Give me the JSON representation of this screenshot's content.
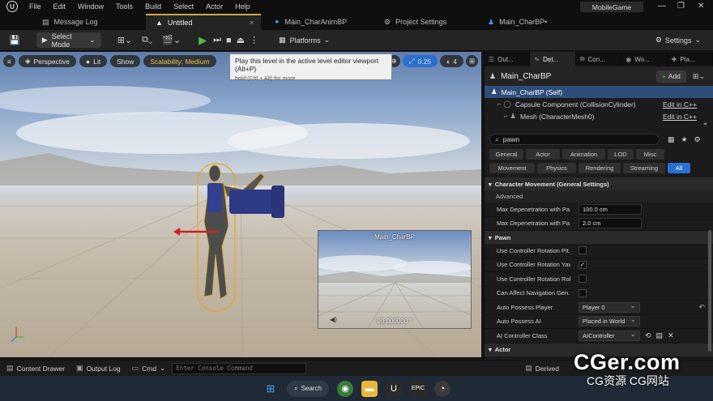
{
  "menu": {
    "items": [
      "File",
      "Edit",
      "Window",
      "Tools",
      "Build",
      "Select",
      "Actor",
      "Help"
    ],
    "app_name": "MobileGame"
  },
  "tabs": [
    {
      "label": "Message Log",
      "icon": "message-log-icon"
    },
    {
      "label": "Untitled",
      "icon": "level-icon"
    },
    {
      "label": "Main_CharAnimBP",
      "icon": "anim-blueprint-icon"
    },
    {
      "label": "Project Settings",
      "icon": "settings-icon"
    },
    {
      "label": "Main_CharBP•",
      "icon": "blueprint-icon"
    }
  ],
  "toolbar": {
    "select_mode": "Select Mode",
    "platforms": "Platforms",
    "settings": "Settings"
  },
  "viewport": {
    "perspective": "Perspective",
    "lit": "Lit",
    "show": "Show",
    "scalability": "Scalability: Medium",
    "camera_speed": "0.25",
    "grid_count": "4",
    "tooltip_title": "Play this level in the active level editor viewport (Alt+P)",
    "tooltip_hint": "hold (Ctrl + Alt) for more",
    "preview_title": "Main_CharBP",
    "preview_fov": "90.000000 °"
  },
  "details": {
    "panel_tabs": [
      {
        "label": "Out...",
        "icon": "outliner-icon"
      },
      {
        "label": "Det...",
        "icon": "details-icon"
      },
      {
        "label": "Con...",
        "icon": "components-icon"
      },
      {
        "label": "Wo...",
        "icon": "world-icon"
      },
      {
        "label": "Pla...",
        "icon": "place-icon"
      }
    ],
    "actor_name": "Main_CharBP",
    "add_label": "Add",
    "tree": {
      "self": "Main_CharBP (Self)",
      "capsule": "Capsule Component (CollisionCylinder)",
      "mesh": "Mesh (CharacterMesh0)",
      "edit_cpp": "Edit in C++"
    },
    "search_value": "pawn",
    "categories_row1": [
      "General",
      "Actor",
      "Animation",
      "LOD",
      "Misc"
    ],
    "categories_row2": [
      "Movement",
      "Physics",
      "Rendering",
      "Streaming",
      "All"
    ],
    "sections": {
      "char_movement": "Character Movement (General Settings)",
      "advanced": "Advanced",
      "pawn": "Pawn",
      "actor": "Actor"
    },
    "props": {
      "max_depen_1_label": "Max Depenetration with Pa...",
      "max_depen_1_value": "100.0 cm",
      "max_depen_2_label": "Max Depenetration with Pa...",
      "max_depen_2_value": "2.0 cm",
      "use_pitch": "Use Controller Rotation Pit...",
      "use_yaw": "Use Controller Rotation Yaw",
      "use_roll": "Use Controller Rotation Roll",
      "can_affect_nav": "Can Affect Navigation Gen...",
      "auto_possess_player_label": "Auto Possess Player",
      "auto_possess_player_value": "Player 0",
      "auto_possess_ai_label": "Auto Possess AI",
      "auto_possess_ai_value": "Placed in World",
      "ai_controller_label": "AI Controller Class",
      "ai_controller_value": "AIController"
    }
  },
  "bottom": {
    "content_drawer": "Content Drawer",
    "output_log": "Output Log",
    "cmd": "Cmd",
    "cmd_placeholder": "Enter Console Command",
    "derived": "Derived"
  },
  "taskbar": {
    "search": "Search"
  },
  "watermark": {
    "main": "CGer.com",
    "sub": "CG资源 CG网站"
  }
}
